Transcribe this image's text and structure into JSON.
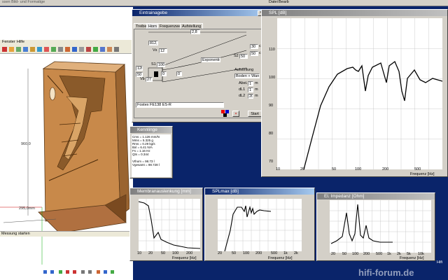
{
  "topbar": {
    "left_title": "ssen Bild- und Formatige",
    "menu_right": [
      "Datei",
      "Bearb"
    ]
  },
  "sketch": {
    "menu": [
      "Fenster",
      "Hilfe"
    ],
    "dim_height": "960,0",
    "dim_width": "295,0mm",
    "status": "Messung starten"
  },
  "dialog": {
    "title": "Eintrainagebe",
    "tabs": [
      "Treiber",
      "Horn",
      "Frequenzweiche",
      "Aufstellung"
    ],
    "length_value": "2,8",
    "rear_value": "812,8",
    "vs_label": "Vs",
    "vs_value": "12",
    "vb_label": "Vb",
    "vb_value": "27",
    "top_value": "30",
    "s2_value": "50",
    "s2_label": "S2",
    "top_unit": "cm",
    "s2_unit": "cm",
    "flare_select": "Exponentiell",
    "s1_label": "S1",
    "s1_value": "100",
    "left_a": "120",
    "left_b": "50",
    "bottom_a": "0",
    "bottom_b": "0",
    "placement_label": "Aufstellung",
    "placement_select": "Boden + Wand",
    "dist_label": "Abst.",
    "dist_value": "1",
    "d1_label": "dL1",
    "d1_value": "1",
    "d2_label": "dL2",
    "d2_value": "20",
    "unit_m": "m",
    "driver_name": "Fostex FE138 ES-R",
    "start_button": "Start"
  },
  "spl_window": {
    "title": "SPL [dB]",
    "y_ticks": [
      "110",
      "100",
      "90",
      "80",
      "70"
    ],
    "x_ticks": [
      "10",
      "20",
      "50",
      "100",
      "200",
      "500"
    ],
    "xlabel": "Frequenz [Hz]"
  },
  "info_window": {
    "title": "Kennlinge",
    "lines": [
      "Cms = 1.126 mm/N",
      "Mms = 5.325 g",
      "Rms = 0.29 kg/s",
      "Bxl = 6.41 N/A",
      "Fs = 1.16 Hz",
      "Qts = 0.344",
      "",
      "Vthom = 98.73 l",
      "Vgesamt = 98.728 l"
    ]
  },
  "bottom_plots": [
    {
      "title": "Membranauslenkung [mm]",
      "xlabel": "Frequenz [Hz]",
      "x_ticks": [
        "10",
        "20",
        "50",
        "100",
        "200"
      ]
    },
    {
      "title": "SPLmax [dB]",
      "xlabel": "Frequenz [Hz]",
      "x_ticks": [
        "20",
        "50",
        "100",
        "200",
        "500",
        "1k",
        "2k"
      ]
    },
    {
      "title": "El. Impedanz [Ohm]",
      "xlabel": "Frequenz [Hz]",
      "x_ticks": [
        "20",
        "50",
        "100",
        "200",
        "500",
        "1k",
        "2k",
        "5k",
        "10k"
      ]
    }
  ],
  "watermark": "hifi-forum.de",
  "taskbar_label": "Hifi"
}
